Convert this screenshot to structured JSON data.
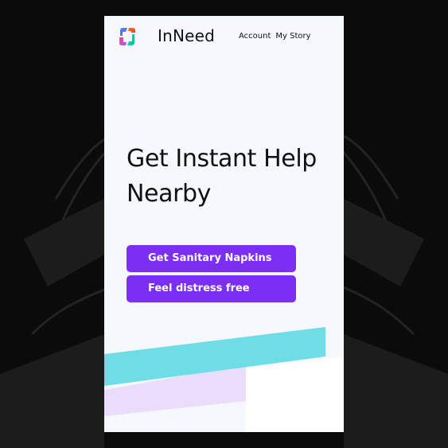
{
  "app": {
    "brand_name": "InNeed"
  },
  "nav": {
    "links": [
      {
        "label": "Account"
      },
      {
        "label": "My Story"
      }
    ]
  },
  "hero": {
    "title": "Get Instant Help Nearby"
  },
  "actions": {
    "primary_label": "Get Sanitary Napkins",
    "secondary_label": "Feel distress free"
  },
  "colors": {
    "accent": "#7b2ff2",
    "teal_stripe": "#6fdde6",
    "lavender_block": "#eadcfb",
    "screen_background": "#f5f8fd"
  },
  "icons": {
    "logo": "innee-logo-icon"
  }
}
